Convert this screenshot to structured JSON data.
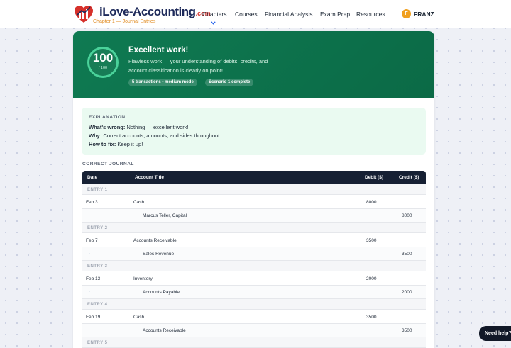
{
  "header": {
    "logo_text": "iLove-Accounting",
    "logo_tld": ".com",
    "logo_subtitle": "Chapter 1 — Journal Entries",
    "nav": [
      {
        "label": "Chapters"
      },
      {
        "label": "Courses"
      },
      {
        "label": "Financial Analysis"
      },
      {
        "label": "Exam Prep"
      },
      {
        "label": "Resources"
      }
    ],
    "user": {
      "initial": "F",
      "name": "FRANZ"
    }
  },
  "result": {
    "score": "100",
    "score_max": "/ 100",
    "title": "Excellent work!",
    "message": "Flawless work — your understanding of debits, credits, and account classification is clearly on point!",
    "badges": [
      "5 transactions • medium mode",
      "Scenario 1 complete"
    ]
  },
  "explanation": {
    "heading": "EXPLANATION",
    "wrong_label": "What's wrong:",
    "wrong_text": "Nothing — excellent work!",
    "why_label": "Why:",
    "why_text": "Correct accounts, amounts, and sides throughout.",
    "fix_label": "How to fix:",
    "fix_text": "Keep it up!"
  },
  "journal": {
    "heading": "CORRECT JOURNAL",
    "columns": {
      "date": "Date",
      "account": "Account Title",
      "debit": "Debit ($)",
      "credit": "Credit ($)"
    },
    "entries": [
      {
        "label": "ENTRY 1",
        "date": "Feb 3",
        "debit_account": "Cash",
        "debit": "8000",
        "credit_account": "Marcus Teller, Capital",
        "credit": "8000"
      },
      {
        "label": "ENTRY 2",
        "date": "Feb 7",
        "debit_account": "Accounts Receivable",
        "debit": "3500",
        "credit_account": "Sales Revenue",
        "credit": "3500"
      },
      {
        "label": "ENTRY 3",
        "date": "Feb 13",
        "debit_account": "Inventory",
        "debit": "2000",
        "credit_account": "Accounts Payable",
        "credit": "2000"
      },
      {
        "label": "ENTRY 4",
        "date": "Feb 19",
        "debit_account": "Cash",
        "debit": "3500",
        "credit_account": "Accounts Receivable",
        "credit": "3500"
      },
      {
        "label": "ENTRY 5"
      }
    ],
    "blank_date": "-"
  },
  "help": {
    "label": "Need help?"
  },
  "colors": {
    "hero": "#0f7a52",
    "accent_ring": "#4ad29a",
    "table_header": "#162033",
    "explain_bg": "#eafaf1"
  }
}
